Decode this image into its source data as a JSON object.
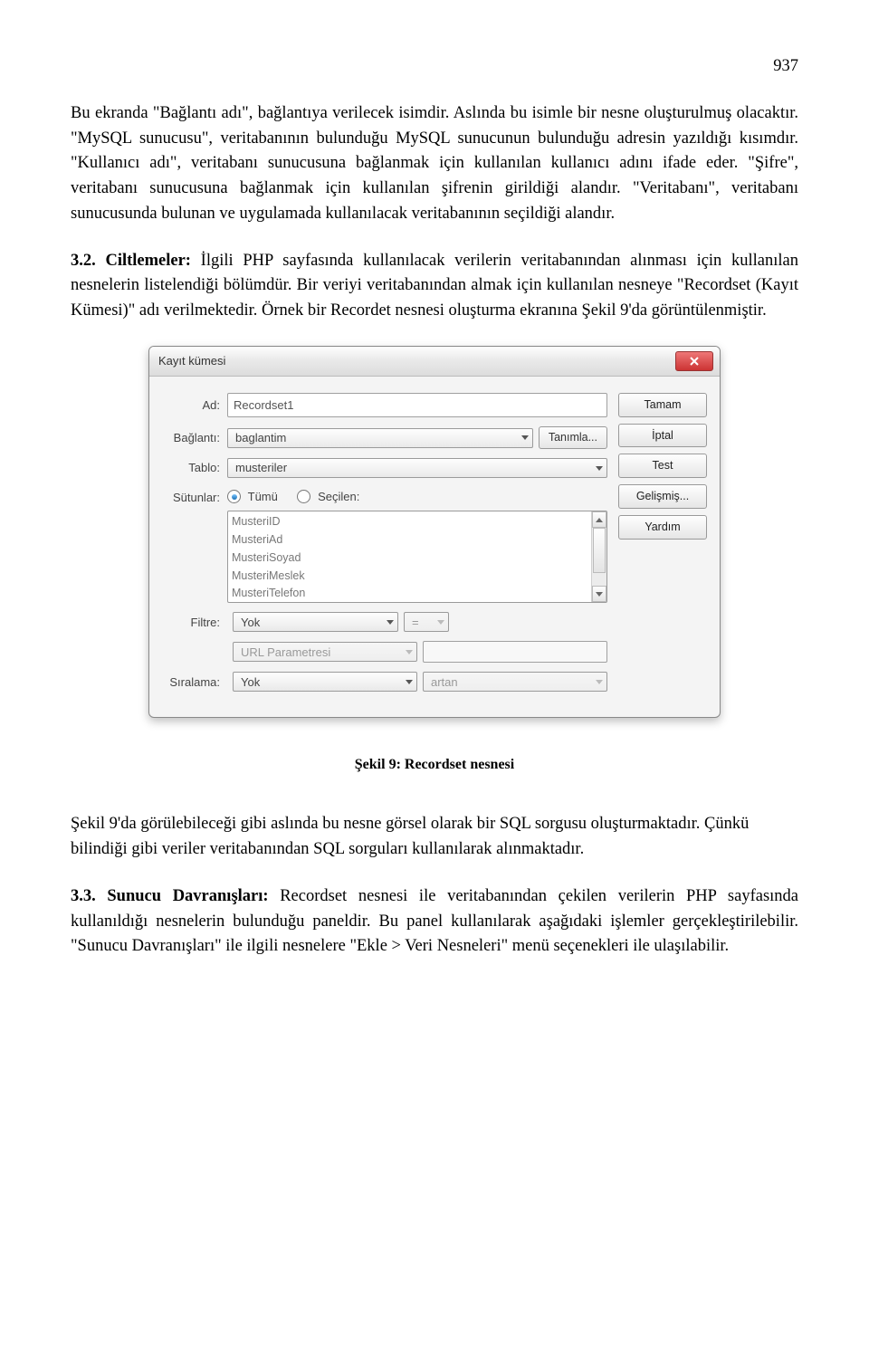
{
  "page_number": "937",
  "para1": "Bu ekranda \"Bağlantı adı\", bağlantıya verilecek isimdir. Aslında bu isimle bir nesne oluşturulmuş olacaktır. \"MySQL sunucusu\", veritabanının bulunduğu MySQL sunucunun bulunduğu adresin yazıldığı kısımdır. \"Kullanıcı adı\", veritabanı sunucusuna bağlanmak için kullanılan kullanıcı adını ifade eder. \"Şifre\", veritabanı sunucusuna bağlanmak için kullanılan şifrenin girildiği alandır. \"Veritabanı\", veritabanı sunucusunda bulunan ve uygulamada kullanılacak veritabanının seçildiği alandır.",
  "sec32_title": "3.2. Ciltlemeler:",
  "sec32_body": " İlgili PHP sayfasında kullanılacak verilerin veritabanından alınması için kullanılan nesnelerin listelendiği bölümdür. Bir veriyi veritabanından almak için kullanılan nesneye \"Recordset (Kayıt Kümesi)\" adı verilmektedir. Örnek bir Recordet nesnesi oluşturma ekranına Şekil 9'da görüntülenmiştir.",
  "caption": "Şekil 9: Recordset nesnesi",
  "para3": "Şekil 9'da görülebileceği gibi aslında bu nesne görsel olarak bir SQL sorgusu oluşturmaktadır. Çünkü bilindiği gibi veriler veritabanından SQL sorguları kullanılarak alınmaktadır.",
  "sec33_title": "3.3. Sunucu Davranışları:",
  "sec33_body": " Recordset nesnesi ile veritabanından çekilen verilerin PHP sayfasında kullanıldığı nesnelerin bulunduğu paneldir. Bu panel kullanılarak aşağıdaki işlemler gerçekleştirilebilir. \"Sunucu Davranışları\" ile ilgili nesnelere \"Ekle > Veri Nesneleri\" menü seçenekleri ile ulaşılabilir.",
  "dialog": {
    "title": "Kayıt kümesi",
    "labels": {
      "ad": "Ad:",
      "baglanti": "Bağlantı:",
      "tablo": "Tablo:",
      "sutunlar": "Sütunlar:",
      "filtre": "Filtre:",
      "siralama": "Sıralama:"
    },
    "fields": {
      "ad": "Recordset1",
      "baglanti": "baglantim",
      "tablo": "musteriler",
      "tanimla": "Tanımla...",
      "radio_tumu": "Tümü",
      "radio_secilen": "Seçilen:",
      "filtre_value": "Yok",
      "eq": "=",
      "url_param": "URL Parametresi",
      "siralama_value": "Yok",
      "artan": "artan"
    },
    "columns": [
      "MusteriID",
      "MusteriAd",
      "MusteriSoyad",
      "MusteriMeslek",
      "MusteriTelefon"
    ],
    "buttons": {
      "tamam": "Tamam",
      "iptal": "İptal",
      "test": "Test",
      "gelismis": "Gelişmiş...",
      "yardim": "Yardım"
    }
  }
}
